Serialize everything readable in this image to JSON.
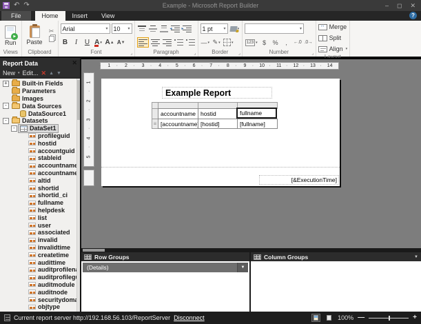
{
  "window": {
    "title": "Example - Microsoft Report Builder",
    "minimize": "–",
    "maximize": "◻",
    "close": "✕"
  },
  "tabs": {
    "file": "File",
    "home": "Home",
    "insert": "Insert",
    "view": "View",
    "help": "?"
  },
  "icons": {
    "undo": "↶",
    "redo": "↷",
    "cut": "✂",
    "pen": "✎",
    "dash": "—",
    "dropdown": "▾",
    "up_arrow": "▲",
    "down_arrow": "▼",
    "grow": "▲",
    "shrink": "▼",
    "num123": "123",
    "currency": "$",
    "percent": "%",
    "comma": ",",
    "inc_decimal": "←.0",
    "dec_decimal": ".0→",
    "row_handle": "≡",
    "launcher": "⌟"
  },
  "ribbon": {
    "views": {
      "label": "Views",
      "run": "Run"
    },
    "clipboard": {
      "label": "Clipboard",
      "paste": "Paste"
    },
    "font": {
      "label": "Font",
      "family": "Arial",
      "size": "10",
      "bold": "B",
      "italic": "I",
      "underline": "U",
      "color_letter": "A",
      "grow_letter": "A",
      "shrink_letter": "A"
    },
    "paragraph": {
      "label": "Paragraph"
    },
    "border": {
      "label": "Border",
      "width": "1 pt"
    },
    "number": {
      "label": "Number",
      "format": ""
    },
    "layout": {
      "label": "Layout",
      "merge": "Merge",
      "split": "Split",
      "align": "Align"
    }
  },
  "report_data": {
    "title": "Report Data",
    "close": "✕",
    "toolbar": {
      "new": "New",
      "edit": "Edit...",
      "delete": "✕",
      "up": "▲",
      "down": "▼"
    },
    "tree": [
      {
        "label": "Built-in Fields",
        "icon": "folder",
        "expand": "+",
        "indent": 0
      },
      {
        "label": "Parameters",
        "icon": "folder",
        "expand": "",
        "indent": 0
      },
      {
        "label": "Images",
        "icon": "folder",
        "expand": "",
        "indent": 0
      },
      {
        "label": "Data Sources",
        "icon": "folder-open",
        "expand": "-",
        "indent": 0
      },
      {
        "label": "DataSource1",
        "icon": "datasource",
        "expand": "",
        "indent": 1
      },
      {
        "label": "Datasets",
        "icon": "folder-open",
        "expand": "-",
        "indent": 0
      },
      {
        "label": "DataSet1",
        "icon": "dataset",
        "expand": "-",
        "indent": 1,
        "selected": true
      },
      {
        "label": "profileguid",
        "icon": "field",
        "expand": "",
        "indent": 2
      },
      {
        "label": "hostid",
        "icon": "field",
        "expand": "",
        "indent": 2
      },
      {
        "label": "accountguid",
        "icon": "field",
        "expand": "",
        "indent": 2
      },
      {
        "label": "stableid",
        "icon": "field",
        "expand": "",
        "indent": 2
      },
      {
        "label": "accountname",
        "icon": "field",
        "expand": "",
        "indent": 2
      },
      {
        "label": "accountname_ci",
        "icon": "field",
        "expand": "",
        "indent": 2
      },
      {
        "label": "altid",
        "icon": "field",
        "expand": "",
        "indent": 2
      },
      {
        "label": "shortid",
        "icon": "field",
        "expand": "",
        "indent": 2
      },
      {
        "label": "shortid_ci",
        "icon": "field",
        "expand": "",
        "indent": 2
      },
      {
        "label": "fullname",
        "icon": "field",
        "expand": "",
        "indent": 2
      },
      {
        "label": "helpdesk",
        "icon": "field",
        "expand": "",
        "indent": 2
      },
      {
        "label": "list",
        "icon": "field",
        "expand": "",
        "indent": 2
      },
      {
        "label": "user",
        "icon": "field",
        "expand": "",
        "indent": 2
      },
      {
        "label": "associated",
        "icon": "field",
        "expand": "",
        "indent": 2
      },
      {
        "label": "invalid",
        "icon": "field",
        "expand": "",
        "indent": 2
      },
      {
        "label": "invalidtime",
        "icon": "field",
        "expand": "",
        "indent": 2
      },
      {
        "label": "createtime",
        "icon": "field",
        "expand": "",
        "indent": 2
      },
      {
        "label": "audittime",
        "icon": "field",
        "expand": "",
        "indent": 2
      },
      {
        "label": "auditprofilename",
        "icon": "field",
        "expand": "",
        "indent": 2
      },
      {
        "label": "auditprofileguid",
        "icon": "field",
        "expand": "",
        "indent": 2
      },
      {
        "label": "auditmodule",
        "icon": "field",
        "expand": "",
        "indent": 2
      },
      {
        "label": "auditnode",
        "icon": "field",
        "expand": "",
        "indent": 2
      },
      {
        "label": "securitydomain",
        "icon": "field",
        "expand": "",
        "indent": 2
      },
      {
        "label": "objtype",
        "icon": "field",
        "expand": "",
        "indent": 2
      }
    ]
  },
  "design": {
    "hruler": [
      "1",
      "2",
      "3",
      "4",
      "5",
      "6",
      "7",
      "8",
      "9",
      "10",
      "11",
      "12",
      "13",
      "14"
    ],
    "vruler": [
      "1",
      "2",
      "3",
      "4",
      "5"
    ],
    "title_textbox": "Example Report",
    "table": {
      "headers": [
        "accountname",
        "hostid",
        "fullname"
      ],
      "cells": [
        "[accountname]",
        "[hostid]",
        "[fullname]"
      ]
    },
    "footer_textbox": "[&ExecutionTime]"
  },
  "groups": {
    "row": {
      "title": "Row Groups",
      "details": "(Details)",
      "dropdown": "▼"
    },
    "column": {
      "title": "Column Groups",
      "dropdown": "▼"
    }
  },
  "status": {
    "server_text": "Current report server http://192.168.56.103/ReportServer",
    "disconnect": "Disconnect",
    "zoom": "100%",
    "minus": "—",
    "plus": "+"
  },
  "colors": {
    "accent_green": "#3fae49",
    "folder_orange": "#e8ad49",
    "delete_red": "#c63a2a",
    "help_blue": "#2e6da4",
    "save_purple": "#8e5bb5",
    "selection_gray": "#dadada"
  }
}
